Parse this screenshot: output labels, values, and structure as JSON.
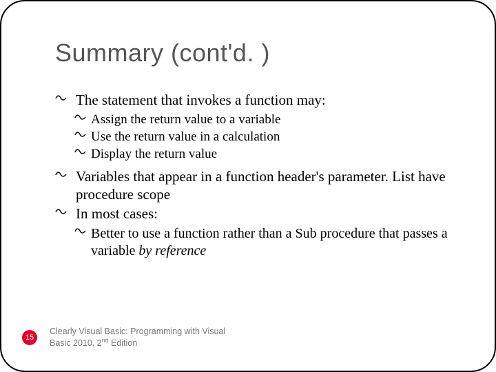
{
  "slide": {
    "title": "Summary (cont'd. )",
    "bullets": {
      "b1": "The statement that invokes a function may:",
      "b1_sub": [
        "Assign the return value to a variable",
        "Use the return value in a calculation",
        "Display the return value"
      ],
      "b2a": "Variables that appear in a function header's parameter. List have procedure scope",
      "b2b": "In most cases:",
      "b2b_sub_pre": "Better to use a function rather than a Sub procedure that passes a variable ",
      "b2b_sub_ital": "by reference"
    },
    "footer": {
      "page": "15",
      "source_pre": "Clearly Visual Basic: Programming with Visual Basic 2010, 2",
      "source_sup": "nd",
      "source_post": " Edition"
    }
  }
}
